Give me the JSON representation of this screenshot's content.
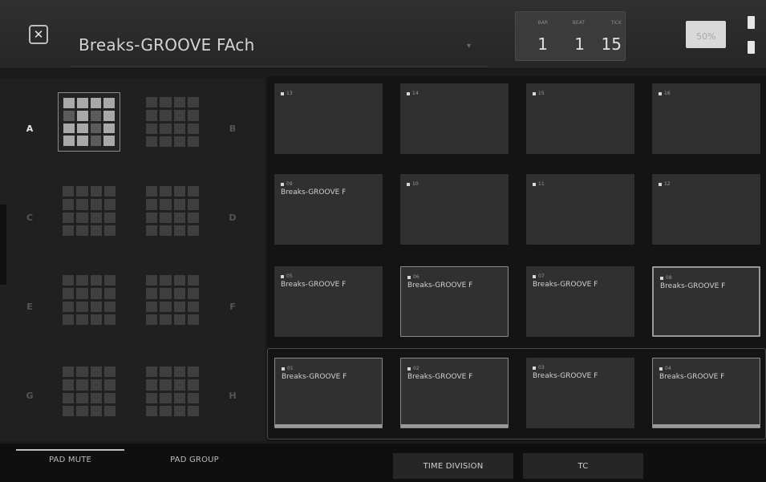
{
  "header": {
    "subtitle": "",
    "title": "Breaks-GROOVE FAch",
    "counter": [
      {
        "label": "BAR",
        "value": "1"
      },
      {
        "label": "BEAT",
        "value": "1"
      },
      {
        "label": "TICK",
        "value": "15"
      }
    ],
    "tempo": {
      "label": "",
      "value": "50%"
    }
  },
  "banks": {
    "letters": [
      "A",
      "B",
      "C",
      "D",
      "E",
      "F",
      "G",
      "H"
    ],
    "selected": "A"
  },
  "pads": [
    {
      "num": "13",
      "name": ""
    },
    {
      "num": "14",
      "name": ""
    },
    {
      "num": "15",
      "name": ""
    },
    {
      "num": "16",
      "name": ""
    },
    {
      "num": "09",
      "name": "Breaks-GROOVE F"
    },
    {
      "num": "10",
      "name": ""
    },
    {
      "num": "11",
      "name": ""
    },
    {
      "num": "12",
      "name": ""
    },
    {
      "num": "05",
      "name": "Breaks-GROOVE F"
    },
    {
      "num": "06",
      "name": "Breaks-GROOVE F"
    },
    {
      "num": "07",
      "name": "Breaks-GROOVE F"
    },
    {
      "num": "08",
      "name": "Breaks-GROOVE F"
    },
    {
      "num": "01",
      "name": "Breaks-GROOVE F"
    },
    {
      "num": "02",
      "name": "Breaks-GROOVE F"
    },
    {
      "num": "03",
      "name": "Breaks-GROOVE F"
    },
    {
      "num": "04",
      "name": "Breaks-GROOVE F"
    }
  ],
  "bottom": {
    "pad_mute": "PAD MUTE",
    "pad_group": "PAD GROUP",
    "time_division": "TIME DIVISION",
    "tc": "TC"
  },
  "colors": {
    "background": "#1b1b1c",
    "pad": "#303031",
    "pad_area": "#141414",
    "accent": "#e6e6e6"
  }
}
